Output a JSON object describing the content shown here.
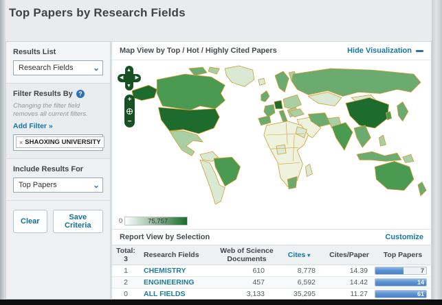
{
  "header": {
    "title": "Top Papers by Research Fields"
  },
  "sidebar": {
    "results_list": {
      "label": "Results List",
      "selected": "Research Fields"
    },
    "filter": {
      "label": "Filter Results By",
      "help_icon": "?",
      "note": "Changing the filter field removes all current filters.",
      "add_filter_label": "Add Filter »",
      "tag": "SHAOXING UNIVERSITY",
      "tag_remove_icon": "×"
    },
    "include_results": {
      "label": "Include Results For",
      "selected": "Top Papers"
    },
    "buttons": {
      "clear": "Clear",
      "save": "Save Criteria"
    }
  },
  "map_section": {
    "title": "Map View by Top / Hot / Highly Cited Papers",
    "hide_link": "Hide Visualization",
    "controls": {
      "zoom_in": "+",
      "zoom_out": "−"
    },
    "legend": {
      "min": "0",
      "max": "75,757"
    },
    "palette": {
      "level4": "#1d6c2d",
      "level3": "#4b9a52",
      "level2": "#6cab70",
      "level1": "#a9cfa5",
      "level0": "#d9e9d4",
      "minimal": "#eff3de",
      "border": "#cf9e30",
      "water": "#ffffff"
    }
  },
  "report": {
    "title": "Report View by Selection",
    "customize_label": "Customize",
    "table": {
      "total_label": "Total:",
      "total_count": "3",
      "headers": {
        "fields": "Research Fields",
        "docs_line1": "Web of Science",
        "docs_line2": "Documents",
        "cites": "Cites",
        "cites_sort_icon": "▾",
        "cites_per_paper": "Cites/Paper",
        "top_papers": "Top Papers"
      },
      "rows": [
        {
          "rank": "1",
          "field": "CHEMISTRY",
          "docs": "610",
          "cites": "8,778",
          "cites_per_paper": "14.39",
          "top_papers": "7",
          "bar_pct": 55
        },
        {
          "rank": "2",
          "field": "ENGINEERING",
          "docs": "457",
          "cites": "6,592",
          "cites_per_paper": "14.42",
          "top_papers": "14",
          "bar_pct": 100
        },
        {
          "rank": "0",
          "field": "ALL FIELDS",
          "docs": "3,133",
          "cites": "35,295",
          "cites_per_paper": "11.27",
          "top_papers": "61",
          "bar_pct": 100
        }
      ]
    }
  },
  "colors": {
    "link_blue": "#1576a8",
    "field_link": "#1c7c9c",
    "bar_blue": "#4a80c4",
    "map_control_green": "#175123",
    "help_icon_blue": "#2e71b8"
  }
}
